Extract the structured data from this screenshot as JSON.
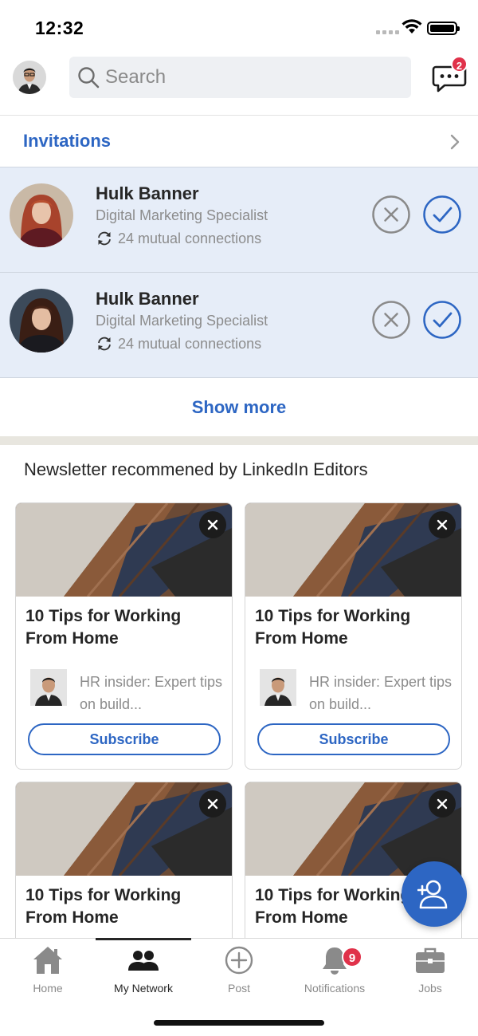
{
  "status": {
    "time": "12:32"
  },
  "header": {
    "search_placeholder": "Search",
    "message_badge": "2"
  },
  "invitations": {
    "title": "Invitations",
    "items": [
      {
        "name": "Hulk Banner",
        "role": "Digital Marketing Specialist",
        "mutual": "24 mutual connections"
      },
      {
        "name": "Hulk Banner",
        "role": "Digital Marketing Specialist",
        "mutual": "24 mutual connections"
      }
    ],
    "show_more": "Show more"
  },
  "newsletter": {
    "title": "Newsletter recommened by LinkedIn Editors",
    "cards": [
      {
        "headline": "10 Tips for Working From Home",
        "author_desc": "HR insider: Expert tips on build...",
        "subscribe": "Subscribe"
      },
      {
        "headline": "10 Tips for Working From Home",
        "author_desc": "HR insider: Expert tips on build...",
        "subscribe": "Subscribe"
      },
      {
        "headline": "10 Tips for Working From Home"
      },
      {
        "headline": "10 Tips for Working From Home"
      }
    ]
  },
  "tabs": [
    {
      "label": "Home",
      "icon": "home-icon"
    },
    {
      "label": "My Network",
      "icon": "network-icon",
      "active": true
    },
    {
      "label": "Post",
      "icon": "plus-circle-icon"
    },
    {
      "label": "Notifications",
      "icon": "bell-icon",
      "badge": "9"
    },
    {
      "label": "Jobs",
      "icon": "briefcase-icon"
    }
  ],
  "colors": {
    "accent": "#2d66c3",
    "badge": "#e0324a",
    "invite_bg": "#e6edf8"
  }
}
